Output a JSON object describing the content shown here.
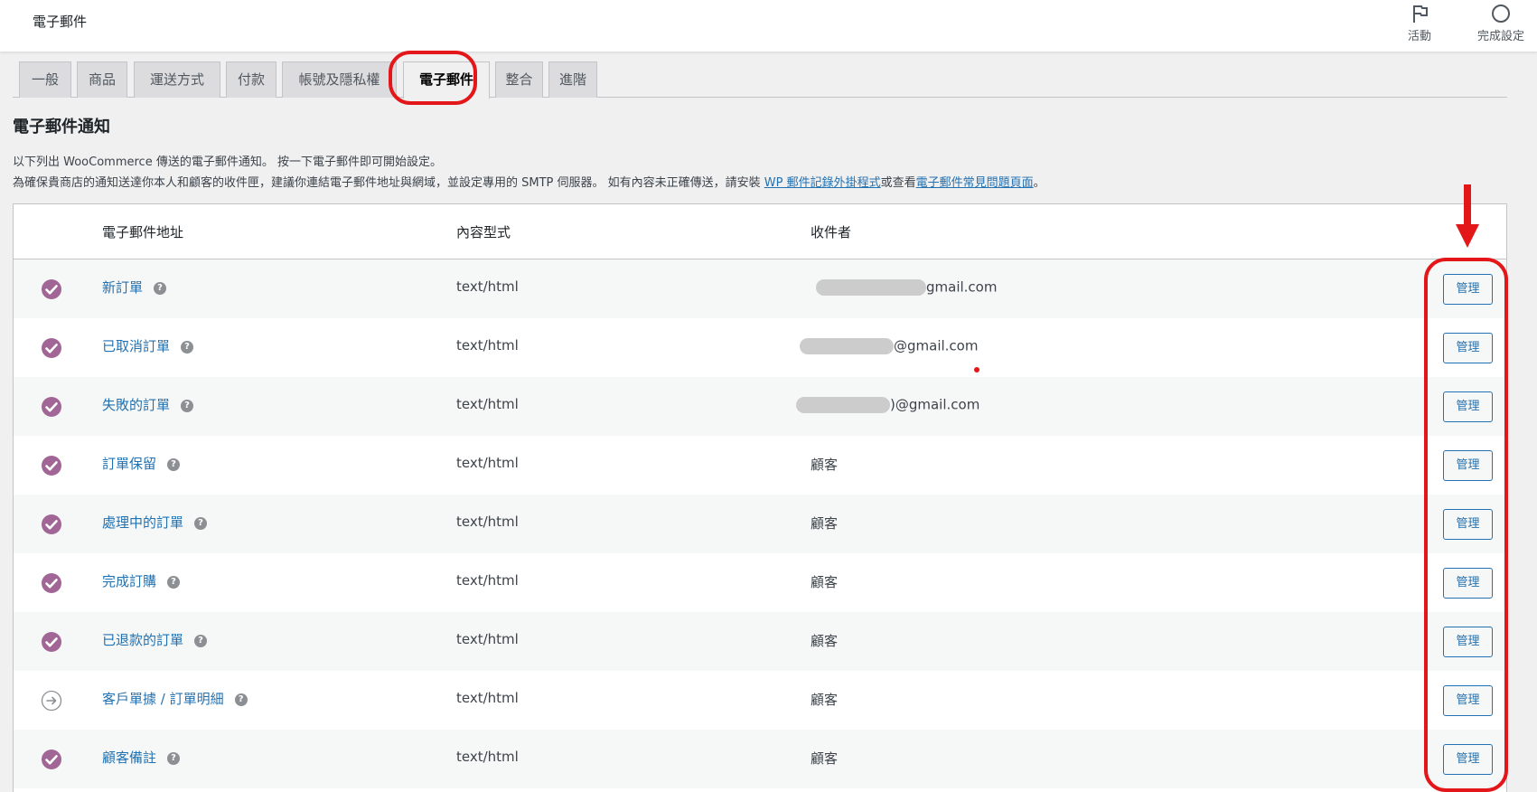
{
  "header": {
    "title": "電子郵件",
    "activity_label": "活動",
    "activity_icon": "flag-icon",
    "setup_label": "完成設定",
    "setup_icon": "progress-circle-icon"
  },
  "tabs": [
    {
      "label": "一般",
      "active": false
    },
    {
      "label": "商品",
      "active": false
    },
    {
      "label": "運送方式",
      "active": false
    },
    {
      "label": "付款",
      "active": false
    },
    {
      "label": "帳號及隱私權",
      "active": false
    },
    {
      "label": "電子郵件",
      "active": true
    },
    {
      "label": "整合",
      "active": false
    },
    {
      "label": "進階",
      "active": false
    }
  ],
  "section": {
    "title": "電子郵件通知",
    "line1": "以下列出 WooCommerce 傳送的電子郵件通知。 按一下電子郵件即可開始設定。",
    "line2_text": "為確保貴商店的通知送達你本人和顧客的收件匣，建議你連結電子郵件地址與網域，並設定專用的 SMTP 伺服器。 如有內容未正確傳送，請安裝 ",
    "line2_link1": "WP 郵件記錄外掛程式",
    "line2_mid": "或查看",
    "line2_link2": "電子郵件常見問題頁面",
    "line2_end": "。"
  },
  "table": {
    "headers": {
      "name": "電子郵件地址",
      "content_type": "內容型式",
      "recipient": "收件者"
    },
    "manage_label": "管理",
    "rows": [
      {
        "name": "新訂單",
        "content_type": "text/html",
        "recipient": "gmail.com",
        "recipient_blurred": true,
        "status": "enabled"
      },
      {
        "name": "已取消訂單",
        "content_type": "text/html",
        "recipient": "@gmail.com",
        "recipient_blurred": true,
        "status": "enabled"
      },
      {
        "name": "失敗的訂單",
        "content_type": "text/html",
        "recipient": ")@gmail.com",
        "recipient_blurred": true,
        "status": "enabled"
      },
      {
        "name": "訂單保留",
        "content_type": "text/html",
        "recipient": "顧客",
        "recipient_blurred": false,
        "status": "enabled"
      },
      {
        "name": "處理中的訂單",
        "content_type": "text/html",
        "recipient": "顧客",
        "recipient_blurred": false,
        "status": "enabled"
      },
      {
        "name": "完成訂購",
        "content_type": "text/html",
        "recipient": "顧客",
        "recipient_blurred": false,
        "status": "enabled"
      },
      {
        "name": "已退款的訂單",
        "content_type": "text/html",
        "recipient": "顧客",
        "recipient_blurred": false,
        "status": "enabled"
      },
      {
        "name": "客戶單據 / 訂單明細",
        "content_type": "text/html",
        "recipient": "顧客",
        "recipient_blurred": false,
        "status": "manual"
      },
      {
        "name": "顧客備註",
        "content_type": "text/html",
        "recipient": "顧客",
        "recipient_blurred": false,
        "status": "enabled"
      }
    ]
  },
  "colors": {
    "accent": "#2271b1",
    "enabled_check": "#a16696",
    "annotation": "#e3161a"
  }
}
